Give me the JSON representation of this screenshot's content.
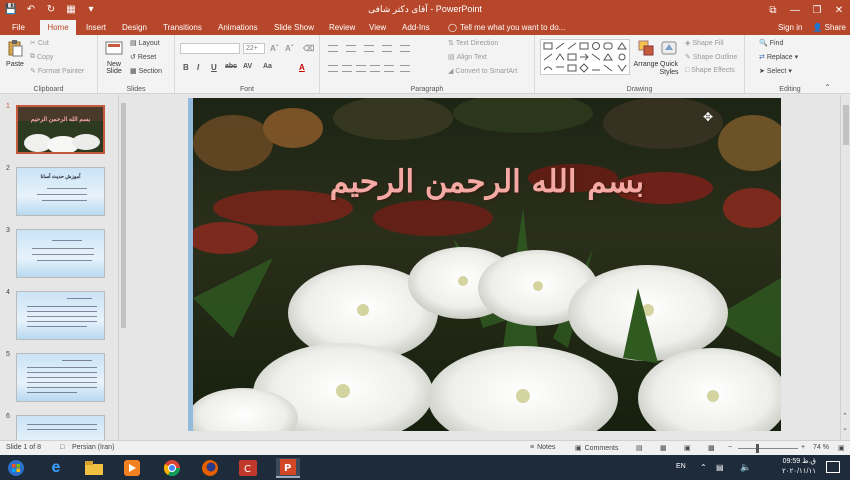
{
  "window": {
    "title": "آقای دکتر شافی - PowerPoint",
    "minimize": "—",
    "restore": "❐",
    "close": "✕",
    "ribbon_display": "⧉"
  },
  "tabs": [
    {
      "label": "File",
      "active": false
    },
    {
      "label": "Home",
      "active": true
    },
    {
      "label": "Insert",
      "active": false
    },
    {
      "label": "Design",
      "active": false
    },
    {
      "label": "Transitions",
      "active": false
    },
    {
      "label": "Animations",
      "active": false
    },
    {
      "label": "Slide Show",
      "active": false
    },
    {
      "label": "Review",
      "active": false
    },
    {
      "label": "View",
      "active": false
    },
    {
      "label": "Add-Ins",
      "active": false
    }
  ],
  "tell_me": "Tell me what you want to do...",
  "sign_in": "Sign in",
  "share": "Share",
  "ribbon": {
    "clipboard": {
      "label": "Clipboard",
      "paste": "Paste",
      "cut": "Cut",
      "copy": "Copy",
      "format_painter": "Format Painter"
    },
    "slides": {
      "label": "Slides",
      "new_slide": "New Slide",
      "layout": "Layout",
      "reset": "Reset",
      "section": "Section"
    },
    "font": {
      "label": "Font",
      "font_size": "22+",
      "bold": "B",
      "italic": "I",
      "underline": "U",
      "strike": "abc",
      "spacing": "AV",
      "case": "Aa",
      "color": "A"
    },
    "paragraph": {
      "label": "Paragraph",
      "text_direction": "Text Direction",
      "align_text": "Align Text",
      "convert_smartart": "Convert to SmartArt"
    },
    "drawing": {
      "label": "Drawing",
      "arrange": "Arrange",
      "quick_styles": "Quick Styles",
      "shape_fill": "Shape Fill",
      "shape_outline": "Shape Outline",
      "shape_effects": "Shape Effects"
    },
    "editing": {
      "label": "Editing",
      "find": "Find",
      "replace": "Replace",
      "select": "Select"
    }
  },
  "thumbnails": [
    {
      "num": "1",
      "active": true,
      "title": "بسم الله الرحمن الرحيم"
    },
    {
      "num": "2",
      "active": false,
      "title": "آموزش حدیث آسانا"
    },
    {
      "num": "3",
      "active": false,
      "title": ""
    },
    {
      "num": "4",
      "active": false,
      "title": ""
    },
    {
      "num": "5",
      "active": false,
      "title": ""
    },
    {
      "num": "6",
      "active": false,
      "title": ""
    }
  ],
  "slide": {
    "title": "بسم الله الرحمن الرحيم"
  },
  "status": {
    "slide_of": "Slide 1 of 8",
    "language": "Persian (Iran)",
    "notes": "Notes",
    "comments": "Comments",
    "zoom": "74 %"
  },
  "taskbar": {
    "lang": "EN",
    "time": "09:59 ق.ظ",
    "date": "۲۰۲۰/۱۱/۱۱"
  },
  "colors": {
    "accent": "#b7472a",
    "title_pink": "#f5a9a4"
  }
}
